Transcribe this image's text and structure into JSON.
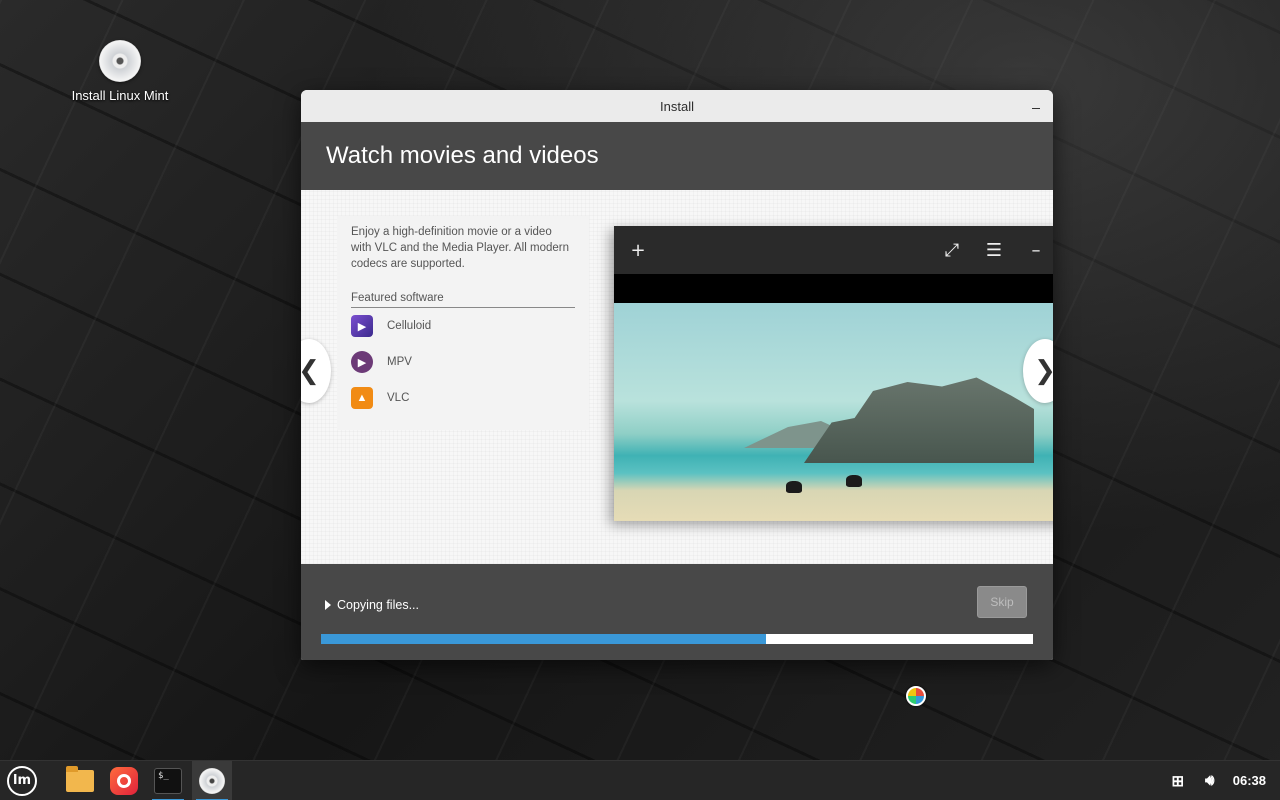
{
  "desktop": {
    "icon_label": "Install Linux Mint"
  },
  "window": {
    "title": "Install",
    "header_title": "Watch movies and videos",
    "description": "Enjoy a high-definition movie or a video with VLC and the Media Player. All modern codecs are supported.",
    "featured_label": "Featured software",
    "software": [
      {
        "name": "Celluloid",
        "icon": "celluloid-icon"
      },
      {
        "name": "MPV",
        "icon": "mpv-icon"
      },
      {
        "name": "VLC",
        "icon": "vlc-icon"
      }
    ],
    "nav_prev": "❮",
    "nav_next": "❯",
    "player_toolbar": {
      "add_icon": "+",
      "fullscreen_icon": "⤢",
      "menu_icon": "☰",
      "minimize_icon": "–"
    },
    "progress": {
      "label": "Copying files...",
      "fraction": 0.625
    },
    "skip_label": "Skip"
  },
  "taskbar": {
    "menu_logo": "lm",
    "clock": "06:38"
  },
  "colors": {
    "accent": "#3a98d8",
    "header_bg": "#484848",
    "progress_track": "#ffffff"
  }
}
